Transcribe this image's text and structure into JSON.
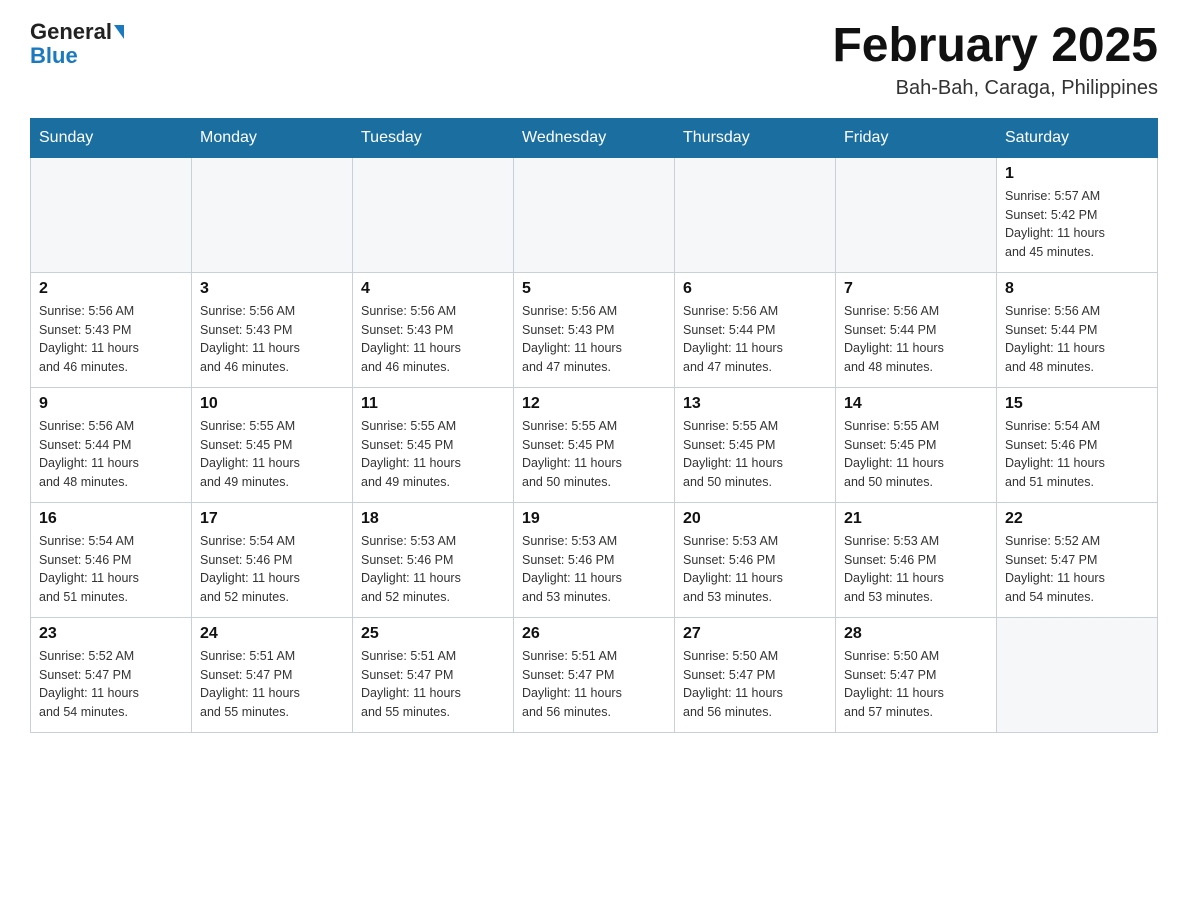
{
  "logo": {
    "text_general": "General",
    "text_blue": "Blue"
  },
  "title": {
    "month_year": "February 2025",
    "location": "Bah-Bah, Caraga, Philippines"
  },
  "weekdays": [
    "Sunday",
    "Monday",
    "Tuesday",
    "Wednesday",
    "Thursday",
    "Friday",
    "Saturday"
  ],
  "weeks": [
    [
      {
        "day": "",
        "info": ""
      },
      {
        "day": "",
        "info": ""
      },
      {
        "day": "",
        "info": ""
      },
      {
        "day": "",
        "info": ""
      },
      {
        "day": "",
        "info": ""
      },
      {
        "day": "",
        "info": ""
      },
      {
        "day": "1",
        "info": "Sunrise: 5:57 AM\nSunset: 5:42 PM\nDaylight: 11 hours\nand 45 minutes."
      }
    ],
    [
      {
        "day": "2",
        "info": "Sunrise: 5:56 AM\nSunset: 5:43 PM\nDaylight: 11 hours\nand 46 minutes."
      },
      {
        "day": "3",
        "info": "Sunrise: 5:56 AM\nSunset: 5:43 PM\nDaylight: 11 hours\nand 46 minutes."
      },
      {
        "day": "4",
        "info": "Sunrise: 5:56 AM\nSunset: 5:43 PM\nDaylight: 11 hours\nand 46 minutes."
      },
      {
        "day": "5",
        "info": "Sunrise: 5:56 AM\nSunset: 5:43 PM\nDaylight: 11 hours\nand 47 minutes."
      },
      {
        "day": "6",
        "info": "Sunrise: 5:56 AM\nSunset: 5:44 PM\nDaylight: 11 hours\nand 47 minutes."
      },
      {
        "day": "7",
        "info": "Sunrise: 5:56 AM\nSunset: 5:44 PM\nDaylight: 11 hours\nand 48 minutes."
      },
      {
        "day": "8",
        "info": "Sunrise: 5:56 AM\nSunset: 5:44 PM\nDaylight: 11 hours\nand 48 minutes."
      }
    ],
    [
      {
        "day": "9",
        "info": "Sunrise: 5:56 AM\nSunset: 5:44 PM\nDaylight: 11 hours\nand 48 minutes."
      },
      {
        "day": "10",
        "info": "Sunrise: 5:55 AM\nSunset: 5:45 PM\nDaylight: 11 hours\nand 49 minutes."
      },
      {
        "day": "11",
        "info": "Sunrise: 5:55 AM\nSunset: 5:45 PM\nDaylight: 11 hours\nand 49 minutes."
      },
      {
        "day": "12",
        "info": "Sunrise: 5:55 AM\nSunset: 5:45 PM\nDaylight: 11 hours\nand 50 minutes."
      },
      {
        "day": "13",
        "info": "Sunrise: 5:55 AM\nSunset: 5:45 PM\nDaylight: 11 hours\nand 50 minutes."
      },
      {
        "day": "14",
        "info": "Sunrise: 5:55 AM\nSunset: 5:45 PM\nDaylight: 11 hours\nand 50 minutes."
      },
      {
        "day": "15",
        "info": "Sunrise: 5:54 AM\nSunset: 5:46 PM\nDaylight: 11 hours\nand 51 minutes."
      }
    ],
    [
      {
        "day": "16",
        "info": "Sunrise: 5:54 AM\nSunset: 5:46 PM\nDaylight: 11 hours\nand 51 minutes."
      },
      {
        "day": "17",
        "info": "Sunrise: 5:54 AM\nSunset: 5:46 PM\nDaylight: 11 hours\nand 52 minutes."
      },
      {
        "day": "18",
        "info": "Sunrise: 5:53 AM\nSunset: 5:46 PM\nDaylight: 11 hours\nand 52 minutes."
      },
      {
        "day": "19",
        "info": "Sunrise: 5:53 AM\nSunset: 5:46 PM\nDaylight: 11 hours\nand 53 minutes."
      },
      {
        "day": "20",
        "info": "Sunrise: 5:53 AM\nSunset: 5:46 PM\nDaylight: 11 hours\nand 53 minutes."
      },
      {
        "day": "21",
        "info": "Sunrise: 5:53 AM\nSunset: 5:46 PM\nDaylight: 11 hours\nand 53 minutes."
      },
      {
        "day": "22",
        "info": "Sunrise: 5:52 AM\nSunset: 5:47 PM\nDaylight: 11 hours\nand 54 minutes."
      }
    ],
    [
      {
        "day": "23",
        "info": "Sunrise: 5:52 AM\nSunset: 5:47 PM\nDaylight: 11 hours\nand 54 minutes."
      },
      {
        "day": "24",
        "info": "Sunrise: 5:51 AM\nSunset: 5:47 PM\nDaylight: 11 hours\nand 55 minutes."
      },
      {
        "day": "25",
        "info": "Sunrise: 5:51 AM\nSunset: 5:47 PM\nDaylight: 11 hours\nand 55 minutes."
      },
      {
        "day": "26",
        "info": "Sunrise: 5:51 AM\nSunset: 5:47 PM\nDaylight: 11 hours\nand 56 minutes."
      },
      {
        "day": "27",
        "info": "Sunrise: 5:50 AM\nSunset: 5:47 PM\nDaylight: 11 hours\nand 56 minutes."
      },
      {
        "day": "28",
        "info": "Sunrise: 5:50 AM\nSunset: 5:47 PM\nDaylight: 11 hours\nand 57 minutes."
      },
      {
        "day": "",
        "info": ""
      }
    ]
  ]
}
